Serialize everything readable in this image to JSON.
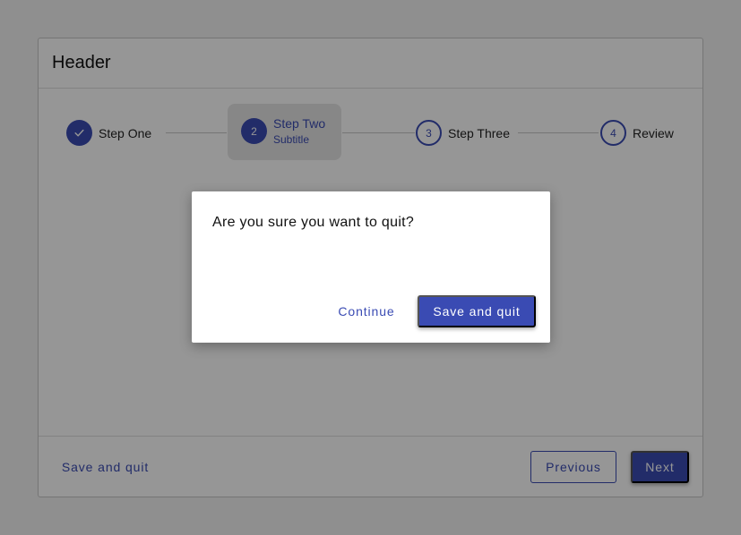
{
  "card": {
    "header_title": "Header"
  },
  "stepper": {
    "steps": [
      {
        "label": "Step One",
        "state": "completed",
        "icon": "check-icon"
      },
      {
        "label": "Step Two",
        "number": "2",
        "subtitle": "Subtitle",
        "state": "active"
      },
      {
        "label": "Step Three",
        "number": "3",
        "state": "pending"
      },
      {
        "label": "Review",
        "number": "4",
        "state": "pending"
      }
    ]
  },
  "footer": {
    "save_quit_label": "Save and quit",
    "previous_label": "Previous",
    "next_label": "Next"
  },
  "dialog": {
    "message": "Are you sure you want to quit?",
    "continue_label": "Continue",
    "save_quit_label": "Save and quit"
  },
  "colors": {
    "accent": "#3a4bb3",
    "scrim": "rgba(0,0,0,0.41)"
  }
}
